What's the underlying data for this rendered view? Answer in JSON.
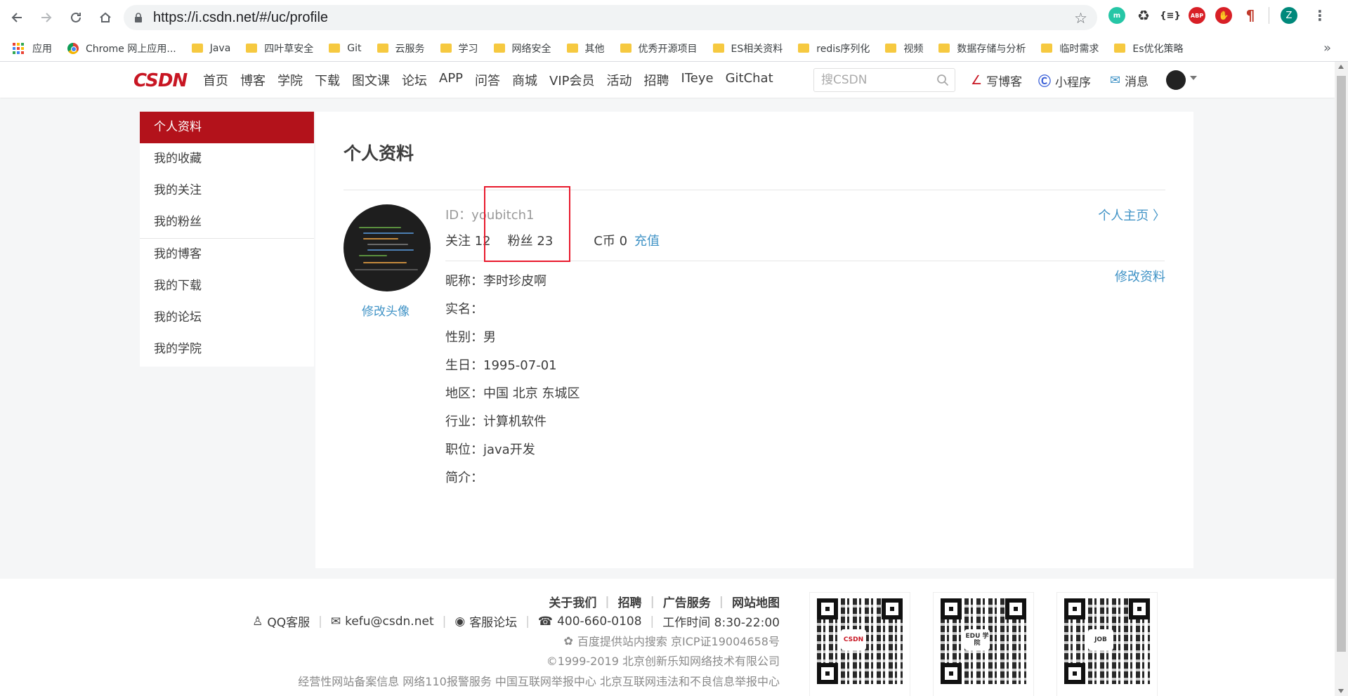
{
  "browser": {
    "url": "https://i.csdn.net/#/uc/profile",
    "profile_initial": "Z",
    "bookmarks": [
      {
        "label": "应用",
        "icon": "apps-grid-icon"
      },
      {
        "label": "Chrome 网上应用...",
        "icon": "chrome-icon"
      },
      {
        "label": "Java",
        "icon": "folder-icon"
      },
      {
        "label": "四叶草安全",
        "icon": "folder-icon"
      },
      {
        "label": "Git",
        "icon": "folder-icon"
      },
      {
        "label": "云服务",
        "icon": "folder-icon"
      },
      {
        "label": "学习",
        "icon": "folder-icon"
      },
      {
        "label": "网络安全",
        "icon": "folder-icon"
      },
      {
        "label": "其他",
        "icon": "folder-icon"
      },
      {
        "label": "优秀开源项目",
        "icon": "folder-icon"
      },
      {
        "label": "ES相关资料",
        "icon": "folder-icon"
      },
      {
        "label": "redis序列化",
        "icon": "folder-icon"
      },
      {
        "label": "视频",
        "icon": "folder-icon"
      },
      {
        "label": "数据存储与分析",
        "icon": "folder-icon"
      },
      {
        "label": "临时需求",
        "icon": "folder-icon"
      },
      {
        "label": "Es优化策略",
        "icon": "folder-icon"
      }
    ],
    "more": "»"
  },
  "header": {
    "logo": "CSDN",
    "nav": [
      "首页",
      "博客",
      "学院",
      "下载",
      "图文课",
      "论坛",
      "APP",
      "问答",
      "商城",
      "VIP会员",
      "活动",
      "招聘",
      "ITeye",
      "GitChat"
    ],
    "search_placeholder": "搜CSDN",
    "write_blog": "写博客",
    "mini_program": "小程序",
    "messages": "消息"
  },
  "sidebar": {
    "items": [
      "个人资料",
      "我的收藏",
      "我的关注",
      "我的粉丝",
      "我的博客",
      "我的下载",
      "我的论坛",
      "我的学院"
    ],
    "active_index": 0
  },
  "profile": {
    "title": "个人资料",
    "id_text": "ID：youbitch1",
    "follow": "关注 12",
    "fans": "粉丝 23",
    "coins": "C币 0",
    "recharge": "充值",
    "homepage_link": "个人主页",
    "edit_avatar": "修改头像",
    "edit_profile": "修改资料",
    "fields": [
      "昵称：李时珍皮啊",
      "实名：",
      "性别：男",
      "生日：1995-07-01",
      "地区：中国 北京 东城区",
      "行业：计算机软件",
      "职位：java开发",
      "简介："
    ]
  },
  "footer": {
    "links": [
      "关于我们",
      "招聘",
      "广告服务",
      "网站地图"
    ],
    "qq": "QQ客服",
    "email": "kefu@csdn.net",
    "forum": "客服论坛",
    "phone": "400-660-0108",
    "hours": "工作时间 8:30-22:00",
    "baidu": "百度提供站内搜索 京ICP证19004658号",
    "copyright": "©1999-2019 北京创新乐知网络技术有限公司",
    "bottom": "经营性网站备案信息 网络110报警服务 中国互联网举报中心 北京互联网违法和不良信息举报中心",
    "qr_labels": [
      "CSDN",
      "EDU 学院",
      "JOB"
    ]
  },
  "colors": {
    "brand_red": "#c81623",
    "active_red": "#b3121b",
    "link_blue": "#4093c6",
    "highlight_box": "#e8192c"
  }
}
